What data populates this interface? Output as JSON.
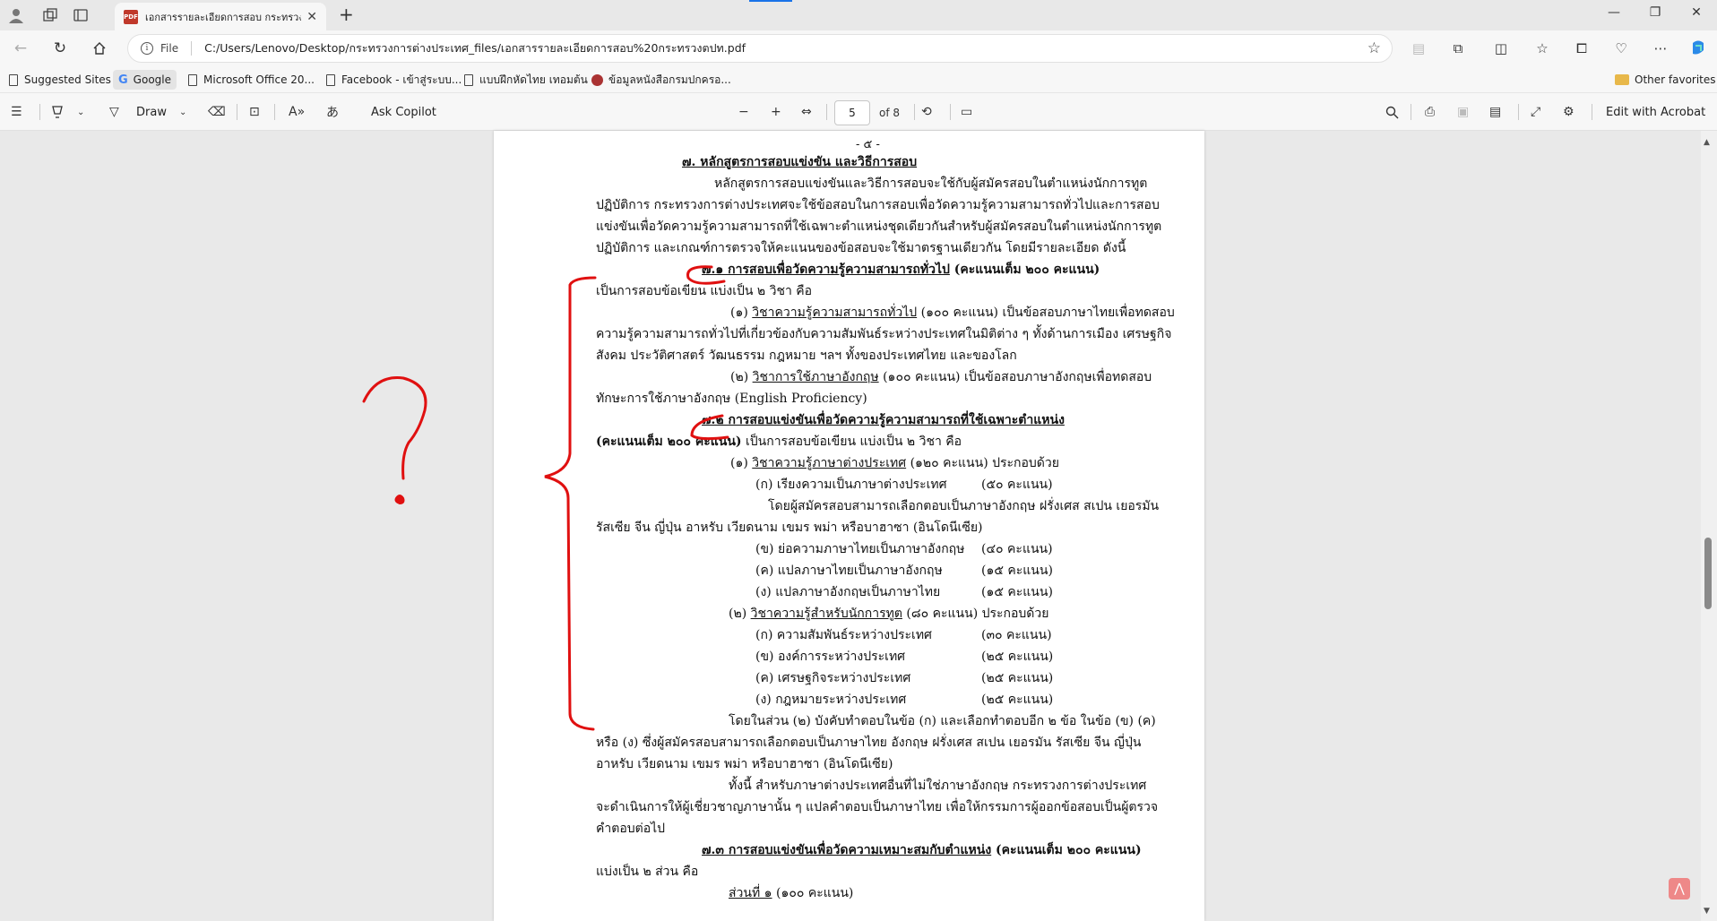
{
  "tab": {
    "title": "เอกสารรายละเอียดการสอบ กระทรวงต่างประเทศ",
    "badge": "PDF"
  },
  "address": {
    "scheme_label": "File",
    "url": "C:/Users/Lenovo/Desktop/กระทรวงการต่างประเทศ_files/เอกสารรายละเอียดการสอบ%20กระทรวงตปท.pdf"
  },
  "favorites": [
    {
      "label": "Suggested Sites"
    },
    {
      "label": "Google"
    },
    {
      "label": "Microsoft Office 20..."
    },
    {
      "label": "Facebook - เข้าสู่ระบบ..."
    },
    {
      "label": "แบบฝึกหัดไทย เทอมต้น"
    },
    {
      "label": "ข้อมูลหนังสือกรมปกครอ..."
    }
  ],
  "other_favorites": "Other favorites",
  "pdf_toolbar": {
    "draw": "Draw",
    "ask_copilot": "Ask Copilot",
    "page_current": "5",
    "page_of": "of 8",
    "edit_acrobat": "Edit with Acrobat"
  },
  "document": {
    "page_no": "- ๕ -",
    "l01": "๗. หลักสูตรการสอบแข่งขัน และวิธีการสอบ",
    "l02": "หลักสูตรการสอบแข่งขันและวิธีการสอบจะใช้กับผู้สมัครสอบในตำแหน่งนักการทูต",
    "l03": "ปฏิบัติการ กระทรวงการต่างประเทศจะใช้ข้อสอบในการสอบเพื่อวัดความรู้ความสามารถทั่วไปและการสอบ",
    "l04": "แข่งขันเพื่อวัดความรู้ความสามารถที่ใช้เฉพาะตำแหน่งชุดเดียวกันสำหรับผู้สมัครสอบในตำแหน่งนักการทูต",
    "l05": "ปฏิบัติการ และเกณฑ์การตรวจให้คะแนนของข้อสอบจะใช้มาตรฐานเดียวกัน โดยมีรายละเอียด ดังนี้",
    "l06a": "๗.๑ การสอบเพื่อวัดความรู้ความสามารถทั่วไป",
    "l06b": " (คะแนนเต็ม ๒๐๐ คะแนน)",
    "l07": "เป็นการสอบข้อเขียน แบ่งเป็น ๒ วิชา คือ",
    "l08a": "(๑) ",
    "l08b": "วิชาความรู้ความสามารถทั่วไป",
    "l08c": " (๑๐๐ คะแนน) เป็นข้อสอบภาษาไทยเพื่อทดสอบ",
    "l09": "ความรู้ความสามารถทั่วไปที่เกี่ยวข้องกับความสัมพันธ์ระหว่างประเทศในมิติต่าง ๆ ทั้งด้านการเมือง เศรษฐกิจ",
    "l10": "สังคม ประวัติศาสตร์ วัฒนธรรม กฎหมาย ฯลฯ ทั้งของประเทศไทย และของโลก",
    "l11a": "(๒) ",
    "l11b": "วิชาการใช้ภาษาอังกฤษ",
    "l11c": " (๑๐๐ คะแนน) เป็นข้อสอบภาษาอังกฤษเพื่อทดสอบ",
    "l12": "ทักษะการใช้ภาษาอังกฤษ (English Proficiency)",
    "l13": "๗.๒ การสอบแข่งขันเพื่อวัดความรู้ความสามารถที่ใช้เฉพาะตำแหน่ง",
    "l14a": "(คะแนนเต็ม ๒๐๐ คะแนน)",
    "l14b": " เป็นการสอบข้อเขียน แบ่งเป็น ๒ วิชา คือ",
    "l15a": "(๑) ",
    "l15b": "วิชาความรู้ภาษาต่างประเทศ",
    "l15c": " (๑๒๐ คะแนน) ประกอบด้วย",
    "l16": "(ก) เรียงความเป็นภาษาต่างประเทศ",
    "l16s": "(๕๐ คะแนน)",
    "l17": "โดยผู้สมัครสอบสามารถเลือกตอบเป็นภาษาอังกฤษ ฝรั่งเศส สเปน เยอรมัน",
    "l18": "รัสเซีย จีน ญี่ปุ่น อาหรับ เวียดนาม เขมร พม่า หรือบาฮาซา (อินโดนีเซีย)",
    "l19": "(ข) ย่อความภาษาไทยเป็นภาษาอังกฤษ",
    "l19s": "(๔๐ คะแนน)",
    "l20": "(ค) แปลภาษาไทยเป็นภาษาอังกฤษ",
    "l20s": "(๑๕ คะแนน)",
    "l21": "(ง) แปลภาษาอังกฤษเป็นภาษาไทย",
    "l21s": "(๑๕ คะแนน)",
    "l22a": "(๒) ",
    "l22b": "วิชาความรู้สำหรับนักการทูต",
    "l22c": " (๘๐ คะแนน) ประกอบด้วย",
    "l23": "(ก) ความสัมพันธ์ระหว่างประเทศ",
    "l23s": "(๓๐ คะแนน)",
    "l24": "(ข) องค์การระหว่างประเทศ",
    "l24s": "(๒๕ คะแนน)",
    "l25": "(ค) เศรษฐกิจระหว่างประเทศ",
    "l25s": "(๒๕ คะแนน)",
    "l26": "(ง) กฎหมายระหว่างประเทศ",
    "l26s": "(๒๕ คะแนน)",
    "l27": "โดยในส่วน (๒) บังคับทำตอบในข้อ (ก) และเลือกทำตอบอีก ๒ ข้อ ในข้อ (ข) (ค)",
    "l28": "หรือ (ง) ซึ่งผู้สมัครสอบสามารถเลือกตอบเป็นภาษาไทย อังกฤษ ฝรั่งเศส สเปน เยอรมัน รัสเซีย จีน ญี่ปุ่น",
    "l29": "อาหรับ เวียดนาม เขมร พม่า หรือบาฮาซา (อินโดนีเซีย)",
    "l30": "ทั้งนี้ สำหรับภาษาต่างประเทศอื่นที่ไม่ใช่ภาษาอังกฤษ กระทรวงการต่างประเทศ",
    "l31": "จะดำเนินการให้ผู้เชี่ยวชาญภาษานั้น ๆ แปลคำตอบเป็นภาษาไทย เพื่อให้กรรมการผู้ออกข้อสอบเป็นผู้ตรวจ",
    "l32": "คำตอบต่อไป",
    "l33a": "๗.๓ การสอบแข่งขันเพื่อวัดความเหมาะสมกับตำแหน่ง",
    "l33b": " (คะแนนเต็ม ๒๐๐ คะแนน)",
    "l34": "แบ่งเป็น ๒ ส่วน คือ",
    "l35a": "ส่วนที่ ๑",
    "l35b": " (๑๐๐ คะแนน)"
  }
}
